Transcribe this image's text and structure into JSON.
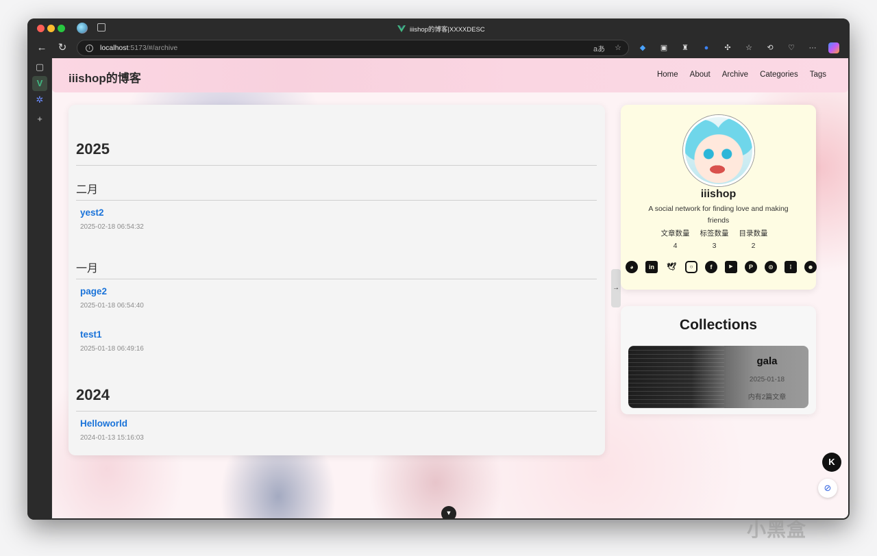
{
  "browser": {
    "tab_title": "iiishop的博客|XXXXDESC",
    "address_host": "localhost",
    "address_path": ":5173/#/archive"
  },
  "site": {
    "title": "iiishop的博客",
    "nav": [
      "Home",
      "About",
      "Archive",
      "Categories",
      "Tags"
    ]
  },
  "archive": {
    "years": [
      {
        "year": "2025",
        "months": [
          {
            "month": "二月",
            "posts": [
              {
                "title": "yest2",
                "date": "2025-02-18 06:54:32"
              }
            ]
          },
          {
            "month": "一月",
            "posts": [
              {
                "title": "page2",
                "date": "2025-01-18 06:54:40"
              },
              {
                "title": "test1",
                "date": "2025-01-18 06:49:16"
              }
            ]
          }
        ]
      },
      {
        "year": "2024",
        "months": [
          {
            "month": "",
            "posts": [
              {
                "title": "Helloworld",
                "date": "2024-01-13 15:16:03"
              }
            ]
          }
        ]
      }
    ]
  },
  "profile": {
    "name": "iiishop",
    "description": "A social network for finding love and making friends",
    "stats": [
      {
        "label": "文章数量",
        "value": "4"
      },
      {
        "label": "标签数量",
        "value": "3"
      },
      {
        "label": "目录数量",
        "value": "2"
      }
    ],
    "socials": [
      "github-icon",
      "linkedin-icon",
      "twitter-icon",
      "instagram-icon",
      "facebook-icon",
      "youtube-icon",
      "pinterest-icon",
      "steam-icon",
      "twitch-icon",
      "reddit-icon"
    ]
  },
  "collections": {
    "title": "Collections",
    "items": [
      {
        "name": "gala",
        "date": "2025-01-18",
        "count_text": "内有2篇文章"
      }
    ]
  },
  "watermark": "小黑盒",
  "colors": {
    "link": "#1a73d9",
    "header_pink": "#fbd7e3",
    "profile_bg": "#fefce3"
  }
}
